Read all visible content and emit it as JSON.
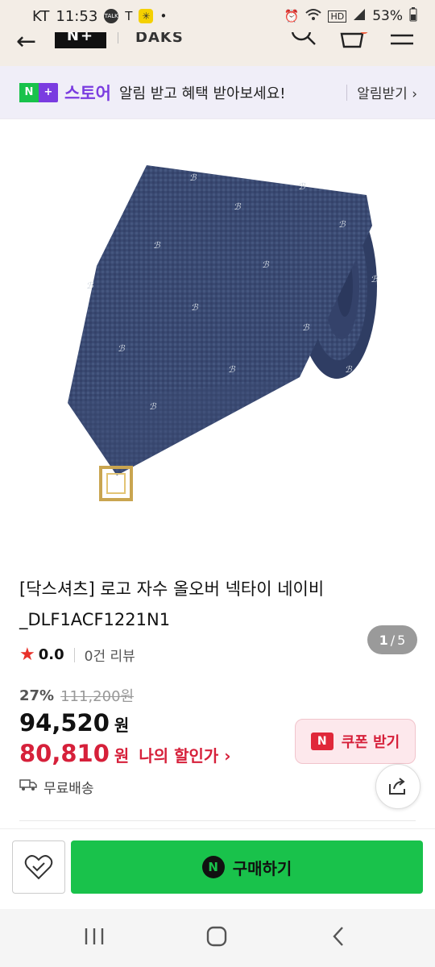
{
  "status_bar": {
    "carrier": "KT",
    "time": "11:53",
    "talk_badge": "TALK",
    "t_letter": "T",
    "kakao_glyph": "✳",
    "dot": "•",
    "hd": "HD",
    "battery": "53%"
  },
  "app_bar": {
    "back_glyph": "←",
    "logo_text": "N+",
    "brand": "DAKS"
  },
  "promo": {
    "badge_n": "N",
    "badge_plus": "+",
    "store_label": "스토어",
    "message": "알림 받고 혜택 받아보세요!",
    "button": "알림받기 ›"
  },
  "gallery": {
    "current": "1",
    "separator": "/",
    "total": "5"
  },
  "product": {
    "title_line1": "[닥스셔츠] 로고 자수 올오버 넥타이 네이비",
    "title_line2": "_DLF1ACF1221N1",
    "rating": "0.0",
    "review_count": "0건 리뷰",
    "discount_percent": "27%",
    "original_price": "111,200원",
    "price": "94,520",
    "price_unit": "원",
    "my_price": "80,810",
    "my_price_unit": "원",
    "my_discount_label": "나의 할인가 ›",
    "coupon_icon": "N",
    "coupon_button": "쿠폰 받기",
    "shipping": "무료배송"
  },
  "bottom_bar": {
    "buy_icon": "N",
    "buy_button": "구매하기"
  },
  "colors": {
    "accent_green": "#19c24b",
    "accent_purple": "#7a3ce0",
    "price_red": "#d6203a",
    "star": "#e8312a"
  }
}
